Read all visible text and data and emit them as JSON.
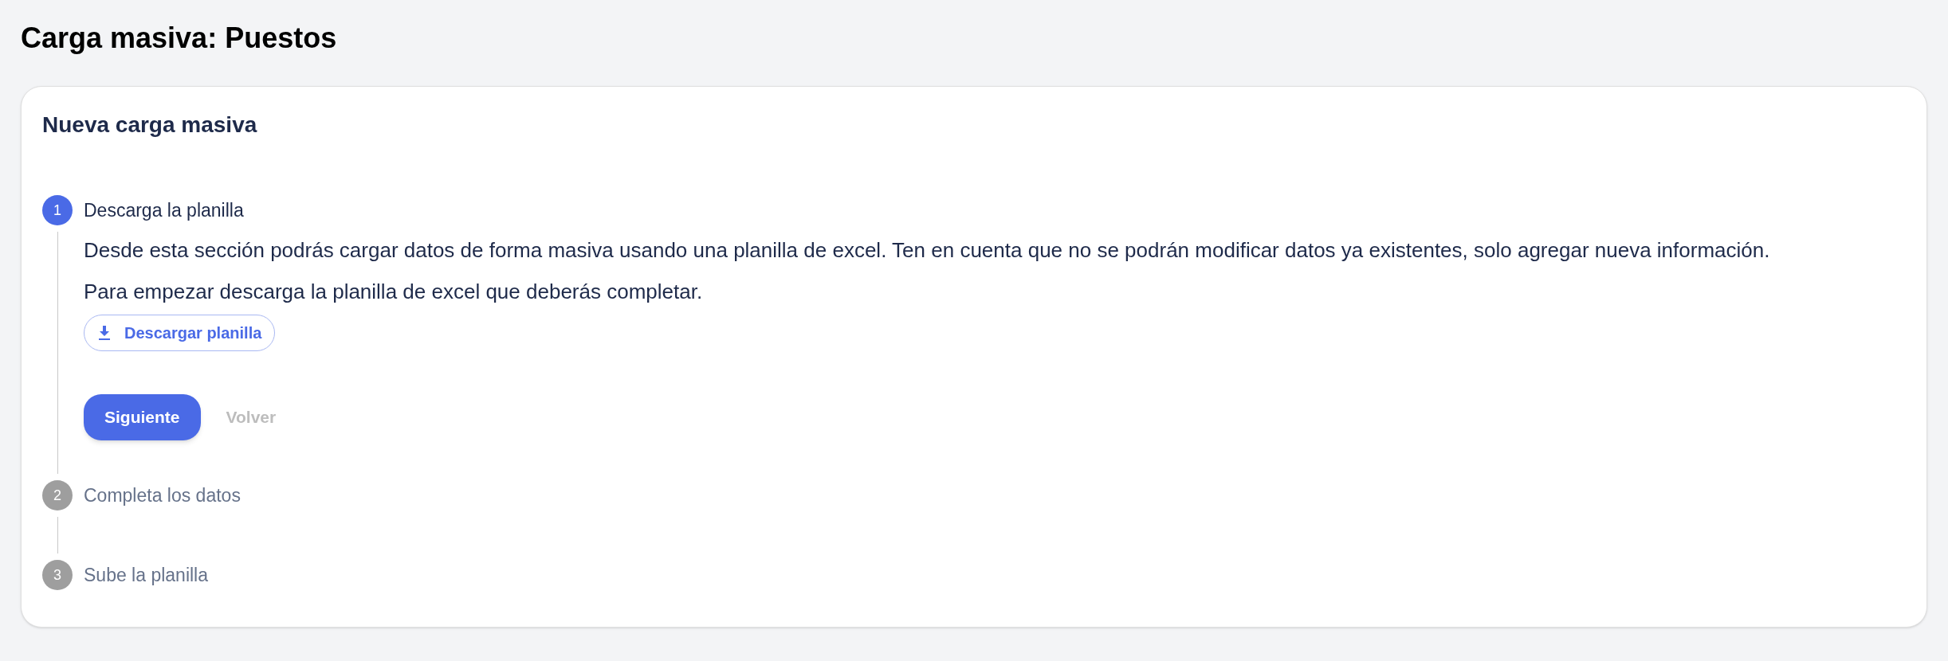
{
  "page_title": "Carga masiva: Puestos",
  "card": {
    "title": "Nueva carga masiva",
    "steps": [
      {
        "number": "1",
        "label": "Descarga la planilla",
        "selected": true,
        "content": {
          "paragraphs": [
            "Desde esta sección podrás cargar datos de forma masiva usando una planilla de excel. Ten en cuenta que no se podrán modificar datos ya existentes, solo agregar nueva información.",
            "Para empezar descarga la planilla de excel que deberás completar."
          ],
          "download_button": "Descargar planilla",
          "next_button": {
            "label": "Siguiente",
            "disabled": false
          },
          "back_button": {
            "label": "Volver",
            "disabled": true
          }
        }
      },
      {
        "number": "2",
        "label": "Completa los datos",
        "selected": false
      },
      {
        "number": "3",
        "label": "Sube la planilla",
        "selected": false
      }
    ]
  }
}
